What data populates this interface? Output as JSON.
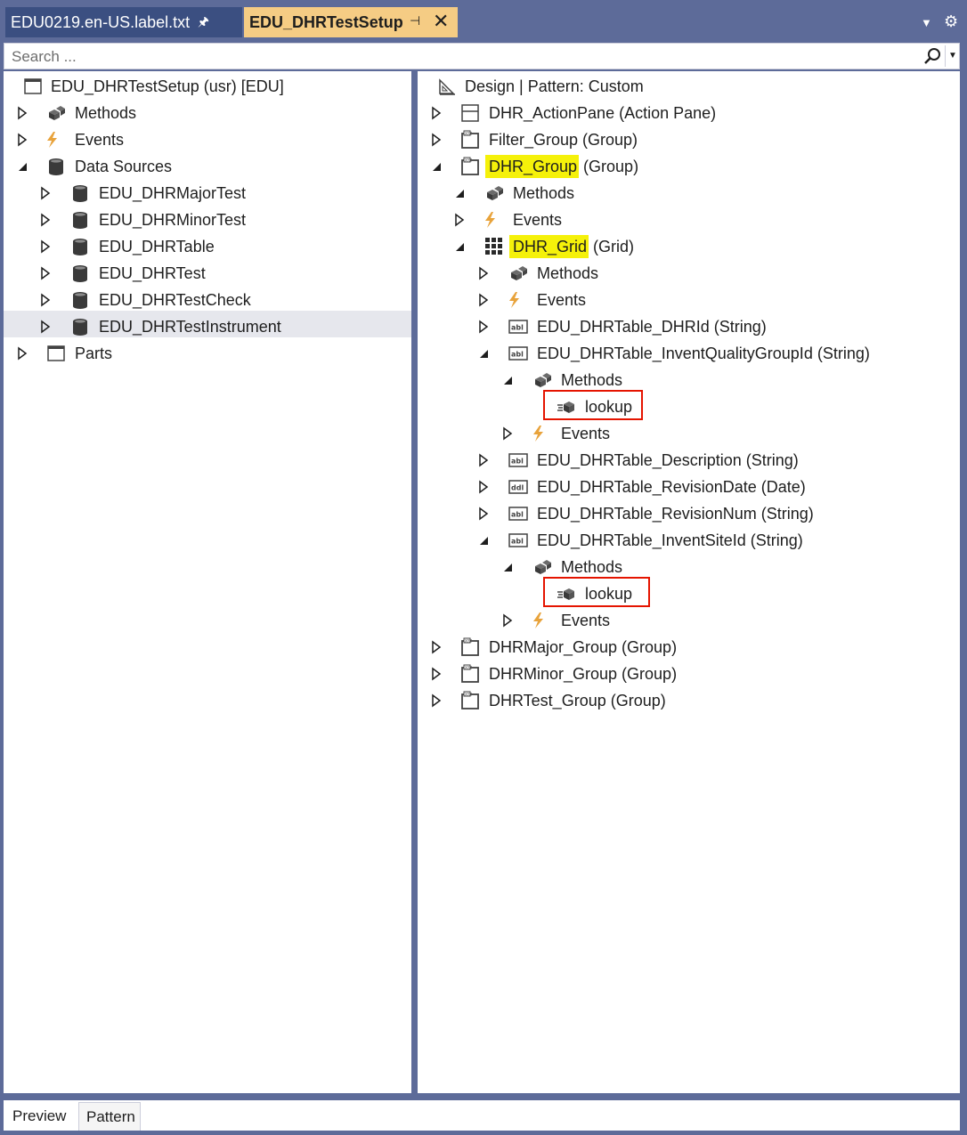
{
  "tabs": {
    "tab1": {
      "label": "EDU0219.en-US.label.txt"
    },
    "tab2": {
      "label": "EDU_DHRTestSetup"
    }
  },
  "search": {
    "placeholder": "Search ..."
  },
  "left_tree": {
    "root": "EDU_DHRTestSetup (usr) [EDU]",
    "methods": "Methods",
    "events": "Events",
    "data_sources": "Data Sources",
    "ds1": "EDU_DHRMajorTest",
    "ds2": "EDU_DHRMinorTest",
    "ds3": "EDU_DHRTable",
    "ds4": "EDU_DHRTest",
    "ds5": "EDU_DHRTestCheck",
    "ds6": "EDU_DHRTestInstrument",
    "parts": "Parts"
  },
  "right_tree": {
    "design": "Design | Pattern: Custom",
    "action_pane": "DHR_ActionPane (Action Pane)",
    "filter_group": "Filter_Group (Group)",
    "dhr_group_name": "DHR_Group",
    "dhr_group_type": " (Group)",
    "g_methods": "Methods",
    "g_events": "Events",
    "dhr_grid_name": "DHR_Grid",
    "dhr_grid_type": " (Grid)",
    "grid_methods": "Methods",
    "grid_events": "Events",
    "f_dhrid": "EDU_DHRTable_DHRId (String)",
    "f_invent_quality": "EDU_DHRTable_InventQualityGroupId (String)",
    "iq_methods": "Methods",
    "iq_lookup": "lookup",
    "iq_events": "Events",
    "f_description": "EDU_DHRTable_Description (String)",
    "f_revision_date": "EDU_DHRTable_RevisionDate (Date)",
    "f_revision_num": "EDU_DHRTable_RevisionNum (String)",
    "f_invent_site": "EDU_DHRTable_InventSiteId (String)",
    "is_methods": "Methods",
    "is_lookup": "lookup",
    "is_events": "Events",
    "major_group": "DHRMajor_Group (Group)",
    "minor_group": "DHRMinor_Group (Group)",
    "test_group": "DHRTest_Group (Group)"
  },
  "bottom_tabs": {
    "preview": "Preview",
    "pattern": "Pattern"
  },
  "colors": {
    "frame": "#5d6b99",
    "active_tab": "#f5cc84",
    "inactive_tab": "#3b4f81",
    "highlight": "#f5f10a",
    "red_box": "#e51400",
    "event_bolt": "#e8a33c"
  }
}
